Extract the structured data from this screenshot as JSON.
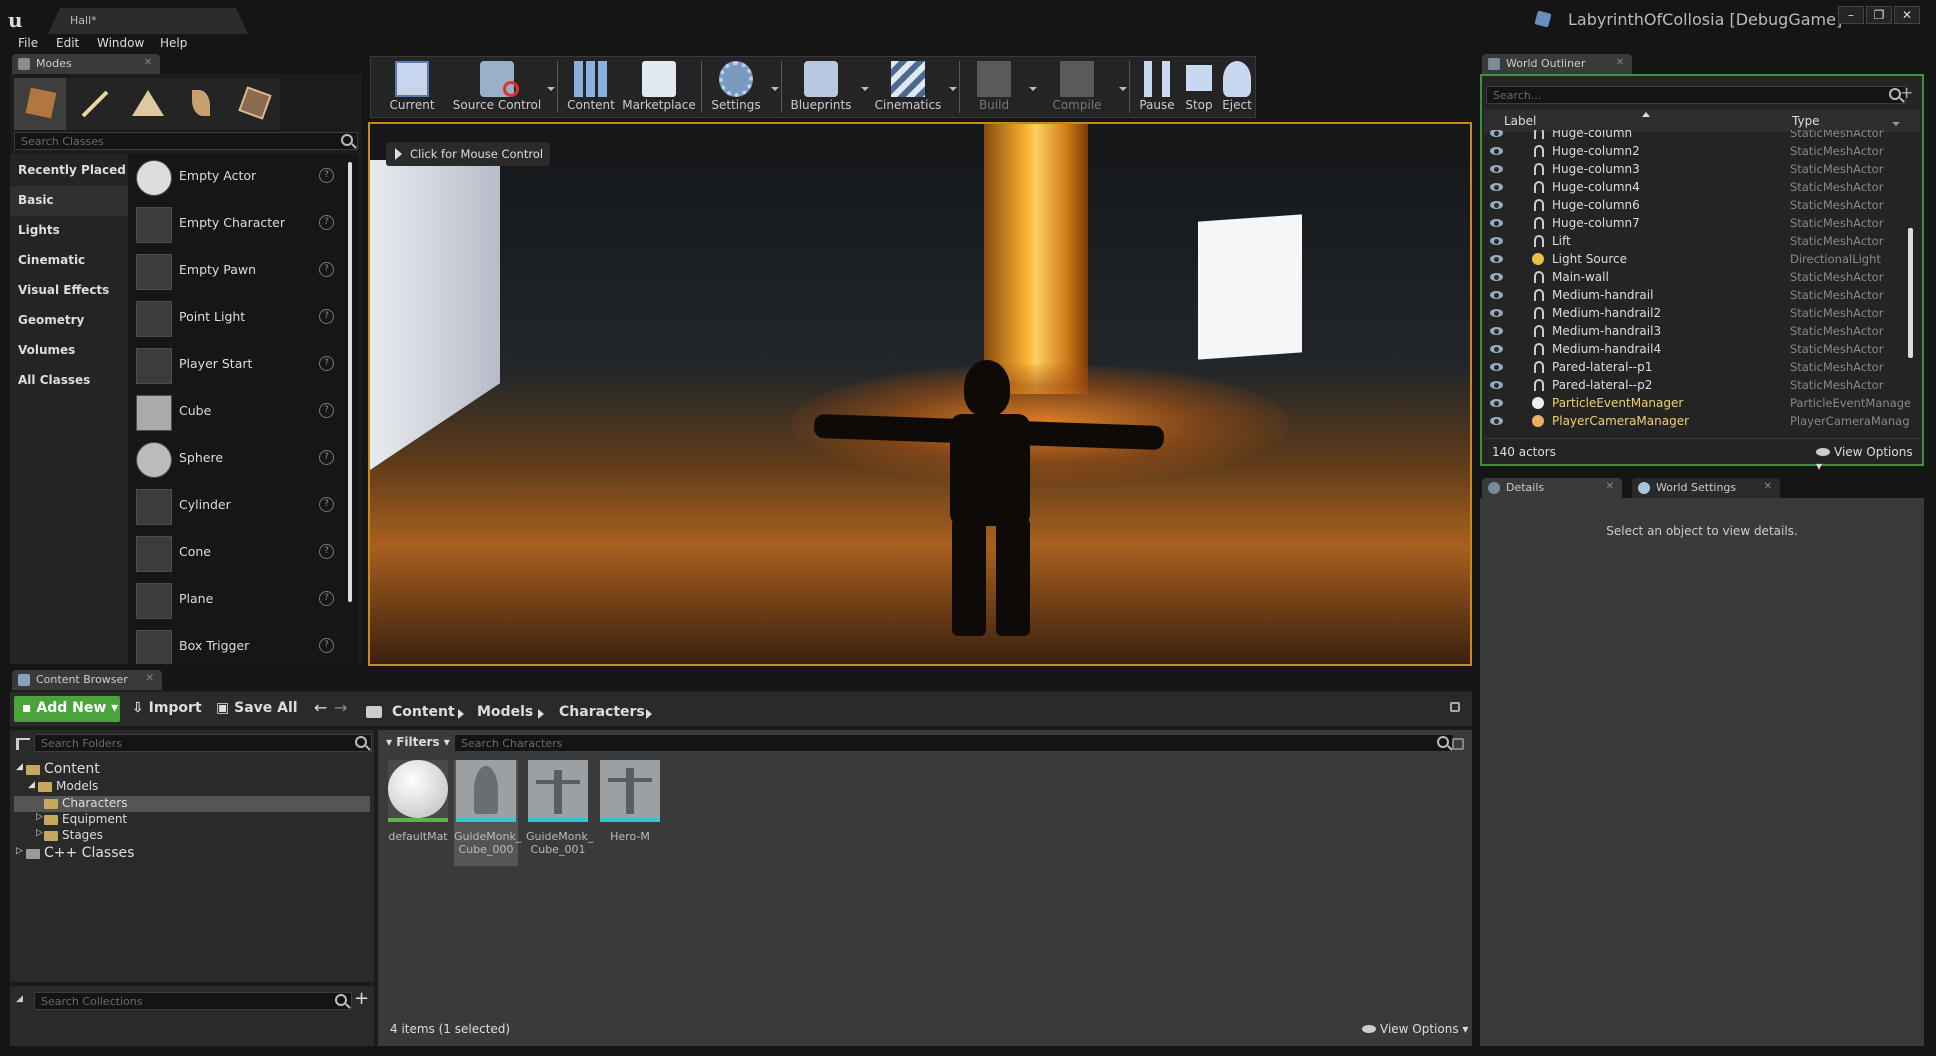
{
  "window": {
    "doc_tab": "Hall*",
    "project_title": "LabyrinthOfCollosia [DebugGame]",
    "min": "–",
    "max": "❐",
    "close": "✕"
  },
  "menu": [
    "File",
    "Edit",
    "Window",
    "Help"
  ],
  "modes": {
    "tab": "Modes",
    "search_placeholder": "Search Classes",
    "categories": [
      "Recently Placed",
      "Basic",
      "Lights",
      "Cinematic",
      "Visual Effects",
      "Geometry",
      "Volumes",
      "All Classes"
    ],
    "selected_category": "Basic",
    "items": [
      "Empty Actor",
      "Empty Character",
      "Empty Pawn",
      "Point Light",
      "Player Start",
      "Cube",
      "Sphere",
      "Cylinder",
      "Cone",
      "Plane",
      "Box Trigger"
    ],
    "help_glyph": "?"
  },
  "toolbar": [
    "Save Current",
    "Source Control",
    "Content",
    "Marketplace",
    "Settings",
    "Blueprints",
    "Cinematics",
    "Build",
    "Compile",
    "Pause",
    "Stop",
    "Eject"
  ],
  "viewport": {
    "hint": "Click for Mouse Control"
  },
  "outliner": {
    "tab": "World Outliner",
    "search_placeholder": "Search...",
    "col_label": "Label",
    "col_type": "Type",
    "rows": [
      {
        "label": "Huge-column",
        "type": "StaticMeshActor"
      },
      {
        "label": "Huge-column2",
        "type": "StaticMeshActor"
      },
      {
        "label": "Huge-column3",
        "type": "StaticMeshActor"
      },
      {
        "label": "Huge-column4",
        "type": "StaticMeshActor"
      },
      {
        "label": "Huge-column6",
        "type": "StaticMeshActor"
      },
      {
        "label": "Huge-column7",
        "type": "StaticMeshActor"
      },
      {
        "label": "Lift",
        "type": "StaticMeshActor"
      },
      {
        "label": "Light Source",
        "type": "DirectionalLight"
      },
      {
        "label": "Main-wall",
        "type": "StaticMeshActor"
      },
      {
        "label": "Medium-handrail",
        "type": "StaticMeshActor"
      },
      {
        "label": "Medium-handrail2",
        "type": "StaticMeshActor"
      },
      {
        "label": "Medium-handrail3",
        "type": "StaticMeshActor"
      },
      {
        "label": "Medium-handrail4",
        "type": "StaticMeshActor"
      },
      {
        "label": "Pared-lateral--p1",
        "type": "StaticMeshActor"
      },
      {
        "label": "Pared-lateral--p2",
        "type": "StaticMeshActor"
      },
      {
        "label": "ParticleEventManager",
        "type": "ParticleEventManage"
      },
      {
        "label": "PlayerCameraManager",
        "type": "PlayerCameraManag"
      }
    ],
    "count": "140 actors",
    "view_options": "View Options"
  },
  "details": {
    "tab_details": "Details",
    "tab_world_settings": "World Settings",
    "empty_msg": "Select an object to view details."
  },
  "content_browser": {
    "tab": "Content Browser",
    "add_new": "Add New",
    "import": "Import",
    "save_all": "Save All",
    "breadcrumb": [
      "Content",
      "Models",
      "Characters"
    ],
    "folder_search": "Search Folders",
    "asset_search": "Search Characters",
    "filters": "Filters",
    "tree": {
      "root": "Content",
      "models": "Models",
      "characters": "Characters",
      "equipment": "Equipment",
      "stages": "Stages",
      "cpp": "C++ Classes"
    },
    "assets": [
      {
        "name": "defaultMat",
        "selected": false
      },
      {
        "name": "GuideMonk_ Cube_000",
        "selected": true
      },
      {
        "name": "GuideMonk_ Cube_001",
        "selected": false
      },
      {
        "name": "Hero-M",
        "selected": false
      }
    ],
    "collections_search": "Search Collections",
    "status": "4 items (1 selected)",
    "view_options": "View Options"
  }
}
